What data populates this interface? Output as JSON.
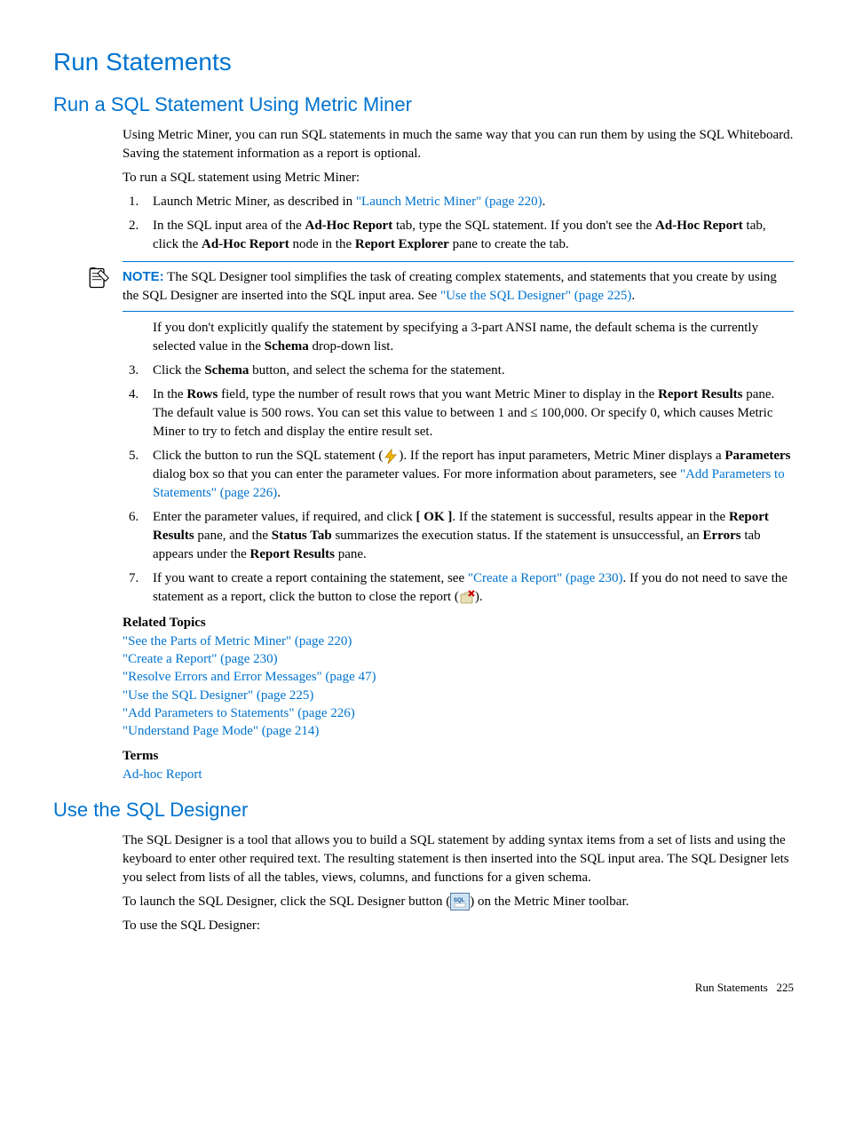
{
  "h1": "Run Statements",
  "section1": {
    "heading": "Run a SQL Statement Using Metric Miner",
    "p1": "Using Metric Miner, you can run SQL statements in much the same way that you can run them by using the SQL Whiteboard. Saving the statement information as a report is optional.",
    "p2": "To run a SQL statement using Metric Miner:",
    "step1_a": "Launch Metric Miner, as described in ",
    "step1_link": "\"Launch Metric Miner\" (page 220)",
    "step1_b": ".",
    "step2_a": "In the SQL input area of the ",
    "step2_b": " tab, type the SQL statement. If you don't see the ",
    "step2_c": " tab, click the ",
    "step2_d": " node in the ",
    "step2_e": " pane to create the tab.",
    "adhoc": "Ad-Hoc Report",
    "report_explorer": "Report Explorer",
    "note_label": "NOTE:",
    "note_a": "The SQL Designer tool simplifies the task of creating complex statements, and statements that you create by using the SQL Designer are inserted into the SQL input area. See ",
    "note_link": "\"Use the SQL Designer\" (page 225)",
    "note_b": ".",
    "p3_a": "If you don't explicitly qualify the statement by specifying a 3-part ANSI name, the default schema is the currently selected value in the ",
    "p3_b": " drop-down list.",
    "schema": "Schema",
    "step3_a": "Click the ",
    "step3_b": " button, and select the schema for the statement.",
    "step4_a": "In the ",
    "rows": "Rows",
    "step4_b": " field, type the number of result rows that you want Metric Miner to display in the ",
    "report_results": "Report Results",
    "step4_c": " pane. The default value is 500 rows. You can set this value to between 1 and ≤ 100,000. Or specify 0, which causes Metric Miner to try to fetch and display the entire result set.",
    "step5_a": "Click the button to run the SQL statement (",
    "step5_b": "). If the report has input parameters, Metric Miner displays a ",
    "parameters": "Parameters",
    "step5_c": " dialog box so that you can enter the parameter values. For more information about parameters, see ",
    "step5_link": "\"Add Parameters to Statements\" (page 226)",
    "step5_d": ".",
    "step6_a": "Enter the parameter values, if required, and click ",
    "ok": "[ OK ]",
    "step6_b": ". If the statement is successful, results appear in the ",
    "step6_c": " pane, and the ",
    "status_tab": "Status Tab",
    "step6_d": " summarizes the execution status. If the statement is unsuccessful, an ",
    "errors": "Errors",
    "step6_e": " tab appears under the ",
    "step6_f": " pane.",
    "step7_a": "If you want to create a report containing the statement, see ",
    "step7_link": "\"Create a Report\" (page 230)",
    "step7_b": ". If you do not need to save the statement as a report, click the button to close the report (",
    "step7_c": ").",
    "related_heading": "Related Topics",
    "related": {
      "r1": "\"See the Parts of Metric Miner\" (page 220)",
      "r2": "\"Create a Report\" (page 230)",
      "r3": "\"Resolve Errors and Error Messages\" (page 47)",
      "r4": "\"Use the SQL Designer\" (page 225)",
      "r5": "\"Add Parameters to Statements\" (page 226)",
      "r6": "\"Understand Page Mode\" (page 214)"
    },
    "terms_heading": "Terms",
    "terms_link": "Ad-hoc Report"
  },
  "section2": {
    "heading": "Use the SQL Designer",
    "p1": "The SQL Designer is a tool that allows you to build a SQL statement by adding syntax items from a set of lists and using the keyboard to enter other required text. The resulting statement is then inserted into the SQL input area. The SQL Designer lets you select from lists of all the tables, views, columns, and functions for a given schema.",
    "p2_a": "To launch the SQL Designer, click the SQL Designer button (",
    "p2_b": ") on the Metric Miner toolbar.",
    "p3": "To use the SQL Designer:"
  },
  "footer_text": "Run Statements",
  "footer_page": "225"
}
